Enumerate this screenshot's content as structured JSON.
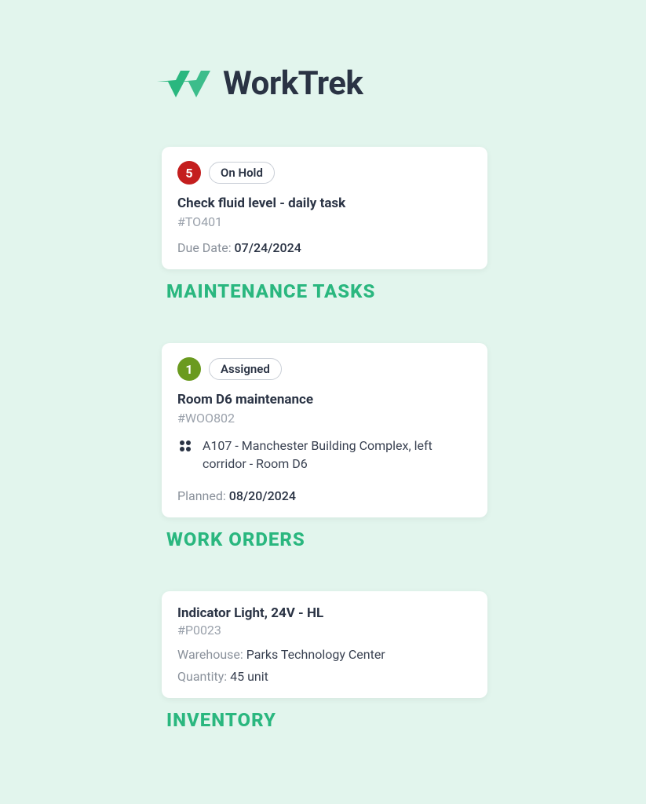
{
  "brand": {
    "name": "WorkTrek"
  },
  "sections": {
    "maintenance": {
      "title": "MAINTENANCE TASKS",
      "card": {
        "priority": "5",
        "status": "On Hold",
        "title": "Check fluid level -  daily task",
        "ref": "#TO401",
        "due_label": "Due Date:",
        "due_value": "07/24/2024"
      }
    },
    "workorders": {
      "title": "WORK ORDERS",
      "card": {
        "priority": "1",
        "status": "Assigned",
        "title": "Room D6 maintenance",
        "ref": "#WOO802",
        "location": "A107 - Manchester Building Complex, left corridor - Room D6",
        "planned_label": "Planned:",
        "planned_value": "08/20/2024"
      }
    },
    "inventory": {
      "title": "INVENTORY",
      "card": {
        "title": "Indicator Light, 24V - HL",
        "ref": "#P0023",
        "warehouse_label": "Warehouse:",
        "warehouse_value": "Parks Technology Center",
        "quantity_label": "Quantity:",
        "quantity_value": "45 unit"
      }
    }
  }
}
